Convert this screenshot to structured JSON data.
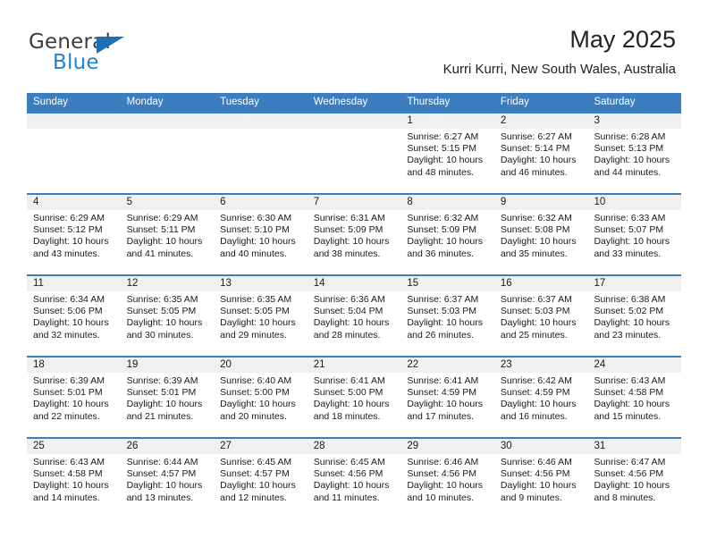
{
  "brand": {
    "name_primary": "General",
    "name_secondary": "Blue",
    "accent_color": "#2183d3",
    "triangle_color": "#1f6fb5"
  },
  "header": {
    "title": "May 2025",
    "location": "Kurri Kurri, New South Wales, Australia"
  },
  "theme": {
    "header_row_bg": "#3b7dbf",
    "day_number_bg": "#f0f0f0",
    "cell_bg": "#ffffff",
    "separator": "#3b7dbf"
  },
  "weekdays": [
    "Sunday",
    "Monday",
    "Tuesday",
    "Wednesday",
    "Thursday",
    "Friday",
    "Saturday"
  ],
  "weeks": [
    {
      "days": [
        {
          "number": "",
          "sunrise": "",
          "sunset": "",
          "daylight_1": "",
          "daylight_2": ""
        },
        {
          "number": "",
          "sunrise": "",
          "sunset": "",
          "daylight_1": "",
          "daylight_2": ""
        },
        {
          "number": "",
          "sunrise": "",
          "sunset": "",
          "daylight_1": "",
          "daylight_2": ""
        },
        {
          "number": "",
          "sunrise": "",
          "sunset": "",
          "daylight_1": "",
          "daylight_2": ""
        },
        {
          "number": "1",
          "sunrise": "Sunrise: 6:27 AM",
          "sunset": "Sunset: 5:15 PM",
          "daylight_1": "Daylight: 10 hours",
          "daylight_2": "and 48 minutes."
        },
        {
          "number": "2",
          "sunrise": "Sunrise: 6:27 AM",
          "sunset": "Sunset: 5:14 PM",
          "daylight_1": "Daylight: 10 hours",
          "daylight_2": "and 46 minutes."
        },
        {
          "number": "3",
          "sunrise": "Sunrise: 6:28 AM",
          "sunset": "Sunset: 5:13 PM",
          "daylight_1": "Daylight: 10 hours",
          "daylight_2": "and 44 minutes."
        }
      ]
    },
    {
      "days": [
        {
          "number": "4",
          "sunrise": "Sunrise: 6:29 AM",
          "sunset": "Sunset: 5:12 PM",
          "daylight_1": "Daylight: 10 hours",
          "daylight_2": "and 43 minutes."
        },
        {
          "number": "5",
          "sunrise": "Sunrise: 6:29 AM",
          "sunset": "Sunset: 5:11 PM",
          "daylight_1": "Daylight: 10 hours",
          "daylight_2": "and 41 minutes."
        },
        {
          "number": "6",
          "sunrise": "Sunrise: 6:30 AM",
          "sunset": "Sunset: 5:10 PM",
          "daylight_1": "Daylight: 10 hours",
          "daylight_2": "and 40 minutes."
        },
        {
          "number": "7",
          "sunrise": "Sunrise: 6:31 AM",
          "sunset": "Sunset: 5:09 PM",
          "daylight_1": "Daylight: 10 hours",
          "daylight_2": "and 38 minutes."
        },
        {
          "number": "8",
          "sunrise": "Sunrise: 6:32 AM",
          "sunset": "Sunset: 5:09 PM",
          "daylight_1": "Daylight: 10 hours",
          "daylight_2": "and 36 minutes."
        },
        {
          "number": "9",
          "sunrise": "Sunrise: 6:32 AM",
          "sunset": "Sunset: 5:08 PM",
          "daylight_1": "Daylight: 10 hours",
          "daylight_2": "and 35 minutes."
        },
        {
          "number": "10",
          "sunrise": "Sunrise: 6:33 AM",
          "sunset": "Sunset: 5:07 PM",
          "daylight_1": "Daylight: 10 hours",
          "daylight_2": "and 33 minutes."
        }
      ]
    },
    {
      "days": [
        {
          "number": "11",
          "sunrise": "Sunrise: 6:34 AM",
          "sunset": "Sunset: 5:06 PM",
          "daylight_1": "Daylight: 10 hours",
          "daylight_2": "and 32 minutes."
        },
        {
          "number": "12",
          "sunrise": "Sunrise: 6:35 AM",
          "sunset": "Sunset: 5:05 PM",
          "daylight_1": "Daylight: 10 hours",
          "daylight_2": "and 30 minutes."
        },
        {
          "number": "13",
          "sunrise": "Sunrise: 6:35 AM",
          "sunset": "Sunset: 5:05 PM",
          "daylight_1": "Daylight: 10 hours",
          "daylight_2": "and 29 minutes."
        },
        {
          "number": "14",
          "sunrise": "Sunrise: 6:36 AM",
          "sunset": "Sunset: 5:04 PM",
          "daylight_1": "Daylight: 10 hours",
          "daylight_2": "and 28 minutes."
        },
        {
          "number": "15",
          "sunrise": "Sunrise: 6:37 AM",
          "sunset": "Sunset: 5:03 PM",
          "daylight_1": "Daylight: 10 hours",
          "daylight_2": "and 26 minutes."
        },
        {
          "number": "16",
          "sunrise": "Sunrise: 6:37 AM",
          "sunset": "Sunset: 5:03 PM",
          "daylight_1": "Daylight: 10 hours",
          "daylight_2": "and 25 minutes."
        },
        {
          "number": "17",
          "sunrise": "Sunrise: 6:38 AM",
          "sunset": "Sunset: 5:02 PM",
          "daylight_1": "Daylight: 10 hours",
          "daylight_2": "and 23 minutes."
        }
      ]
    },
    {
      "days": [
        {
          "number": "18",
          "sunrise": "Sunrise: 6:39 AM",
          "sunset": "Sunset: 5:01 PM",
          "daylight_1": "Daylight: 10 hours",
          "daylight_2": "and 22 minutes."
        },
        {
          "number": "19",
          "sunrise": "Sunrise: 6:39 AM",
          "sunset": "Sunset: 5:01 PM",
          "daylight_1": "Daylight: 10 hours",
          "daylight_2": "and 21 minutes."
        },
        {
          "number": "20",
          "sunrise": "Sunrise: 6:40 AM",
          "sunset": "Sunset: 5:00 PM",
          "daylight_1": "Daylight: 10 hours",
          "daylight_2": "and 20 minutes."
        },
        {
          "number": "21",
          "sunrise": "Sunrise: 6:41 AM",
          "sunset": "Sunset: 5:00 PM",
          "daylight_1": "Daylight: 10 hours",
          "daylight_2": "and 18 minutes."
        },
        {
          "number": "22",
          "sunrise": "Sunrise: 6:41 AM",
          "sunset": "Sunset: 4:59 PM",
          "daylight_1": "Daylight: 10 hours",
          "daylight_2": "and 17 minutes."
        },
        {
          "number": "23",
          "sunrise": "Sunrise: 6:42 AM",
          "sunset": "Sunset: 4:59 PM",
          "daylight_1": "Daylight: 10 hours",
          "daylight_2": "and 16 minutes."
        },
        {
          "number": "24",
          "sunrise": "Sunrise: 6:43 AM",
          "sunset": "Sunset: 4:58 PM",
          "daylight_1": "Daylight: 10 hours",
          "daylight_2": "and 15 minutes."
        }
      ]
    },
    {
      "days": [
        {
          "number": "25",
          "sunrise": "Sunrise: 6:43 AM",
          "sunset": "Sunset: 4:58 PM",
          "daylight_1": "Daylight: 10 hours",
          "daylight_2": "and 14 minutes."
        },
        {
          "number": "26",
          "sunrise": "Sunrise: 6:44 AM",
          "sunset": "Sunset: 4:57 PM",
          "daylight_1": "Daylight: 10 hours",
          "daylight_2": "and 13 minutes."
        },
        {
          "number": "27",
          "sunrise": "Sunrise: 6:45 AM",
          "sunset": "Sunset: 4:57 PM",
          "daylight_1": "Daylight: 10 hours",
          "daylight_2": "and 12 minutes."
        },
        {
          "number": "28",
          "sunrise": "Sunrise: 6:45 AM",
          "sunset": "Sunset: 4:56 PM",
          "daylight_1": "Daylight: 10 hours",
          "daylight_2": "and 11 minutes."
        },
        {
          "number": "29",
          "sunrise": "Sunrise: 6:46 AM",
          "sunset": "Sunset: 4:56 PM",
          "daylight_1": "Daylight: 10 hours",
          "daylight_2": "and 10 minutes."
        },
        {
          "number": "30",
          "sunrise": "Sunrise: 6:46 AM",
          "sunset": "Sunset: 4:56 PM",
          "daylight_1": "Daylight: 10 hours",
          "daylight_2": "and 9 minutes."
        },
        {
          "number": "31",
          "sunrise": "Sunrise: 6:47 AM",
          "sunset": "Sunset: 4:56 PM",
          "daylight_1": "Daylight: 10 hours",
          "daylight_2": "and 8 minutes."
        }
      ]
    }
  ]
}
